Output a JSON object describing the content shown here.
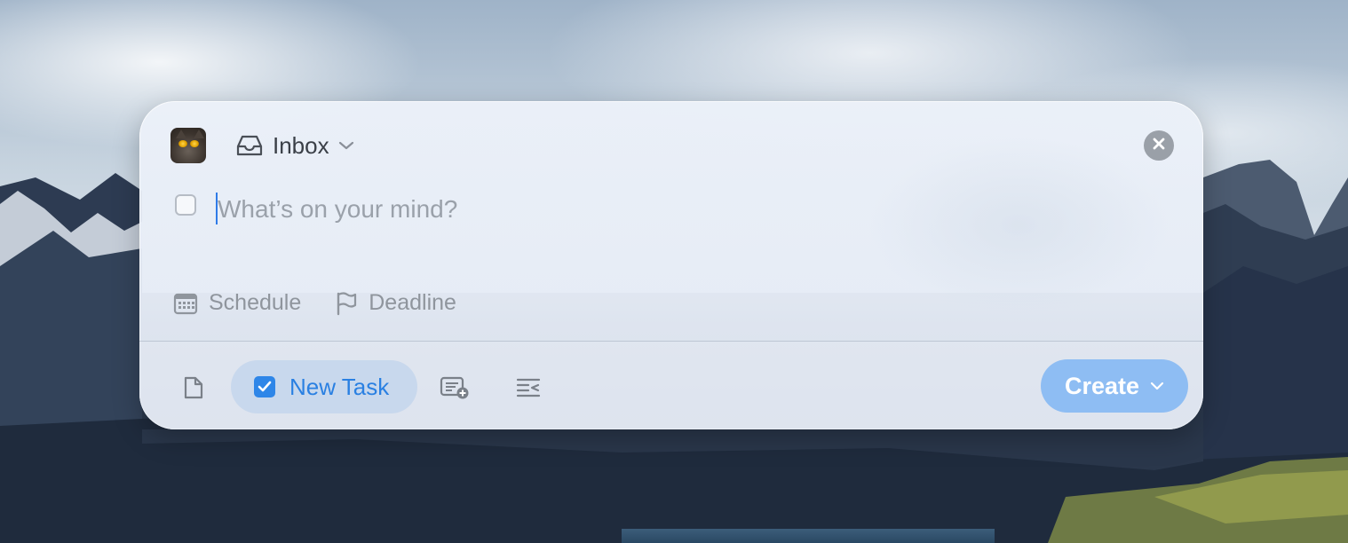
{
  "window": {
    "list_selector": {
      "label": "Inbox",
      "icon": "inbox-tray-icon"
    },
    "close_icon": "close-icon"
  },
  "task": {
    "title_value": "",
    "title_placeholder": "What’s on your mind?",
    "completed": false
  },
  "meta": {
    "schedule_label": "Schedule",
    "deadline_label": "Deadline"
  },
  "toolbar": {
    "note_icon": "document-icon",
    "item_type_label": "New Task",
    "add_list_icon": "list-add-icon",
    "sort_icon": "indent-icon",
    "create_label": "Create"
  },
  "colors": {
    "accent": "#2e86e8",
    "create_button": "#8ebdf3",
    "placeholder": "#9aa1aa"
  }
}
